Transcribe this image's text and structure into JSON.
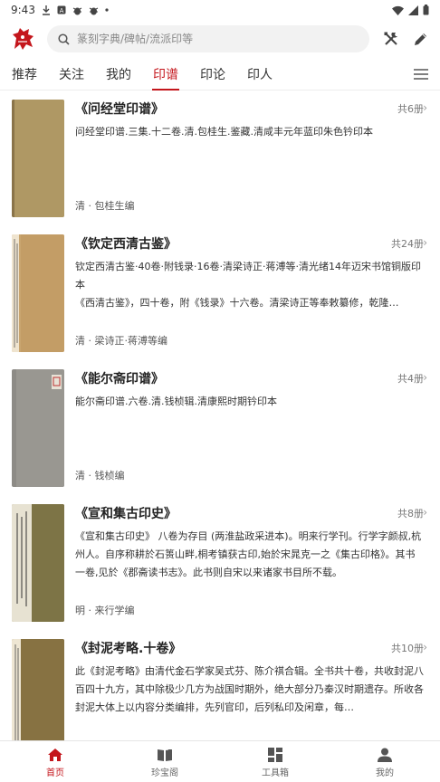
{
  "status_bar": {
    "time": "9:43"
  },
  "search": {
    "placeholder": "篆刻字典/碑帖/流派印等"
  },
  "tabs": [
    {
      "label": "推荐"
    },
    {
      "label": "关注"
    },
    {
      "label": "我的"
    },
    {
      "label": "印谱",
      "active": true
    },
    {
      "label": "印论"
    },
    {
      "label": "印人"
    }
  ],
  "items": [
    {
      "title": "《问经堂印谱》",
      "count": "共6册",
      "desc": [
        "问经堂印谱.三集.十二卷.清.包桂生.鉴藏.清咸丰元年蓝印朱色钤印本"
      ],
      "author": "清 · 包桂生编"
    },
    {
      "title": "《钦定西清古鉴》",
      "count": "共24册",
      "desc": [
        "钦定西清古鉴·40卷·附钱录·16卷·清梁诗正·蒋溥等·清光绪14年迈宋书馆铜版印本",
        "《西清古鉴》，四十卷，附《钱录》十六卷。清梁诗正等奉敕纂修，乾隆…"
      ],
      "author": "清 · 梁诗正·蒋溥等编"
    },
    {
      "title": "《能尔斋印谱》",
      "count": "共4册",
      "desc": [
        "能尔斋印谱.六卷.清.钱桢辑.清康熙时期钤印本"
      ],
      "author": "清 · 钱桢编"
    },
    {
      "title": "《宣和集古印史》",
      "count": "共8册",
      "desc": [
        "《宣和集古印史》 八卷为存目 (两淮盐政采进本)。明来行学刊。行学字颜叔,杭州人。自序称耕於石篑山畔,桐考镇获古印,始於宋晁克一之《集古印格》。其书一卷,见於《郡斋读书志》。此书则自宋以来诸家书目所不载。"
      ],
      "author": "明 · 来行学编"
    },
    {
      "title": "《封泥考略.十卷》",
      "count": "共10册",
      "desc": [
        "此《封泥考略》由清代金石学家吴式芬、陈介祺合辑。全书共十卷，共收封泥八百四十九方，其中除极少几方为战国时期外，绝大部分乃秦汉时期遗存。所收各封泥大体上以内容分类编排，先列官印，后列私印及闲章，每…"
      ],
      "author": ""
    }
  ],
  "bottom_nav": [
    {
      "label": "首页",
      "active": true,
      "icon": "home-icon"
    },
    {
      "label": "珍宝阁",
      "icon": "book-icon"
    },
    {
      "label": "工具箱",
      "icon": "grid-icon"
    },
    {
      "label": "我的",
      "icon": "person-icon"
    }
  ],
  "colors": {
    "accent": "#c4161c"
  }
}
